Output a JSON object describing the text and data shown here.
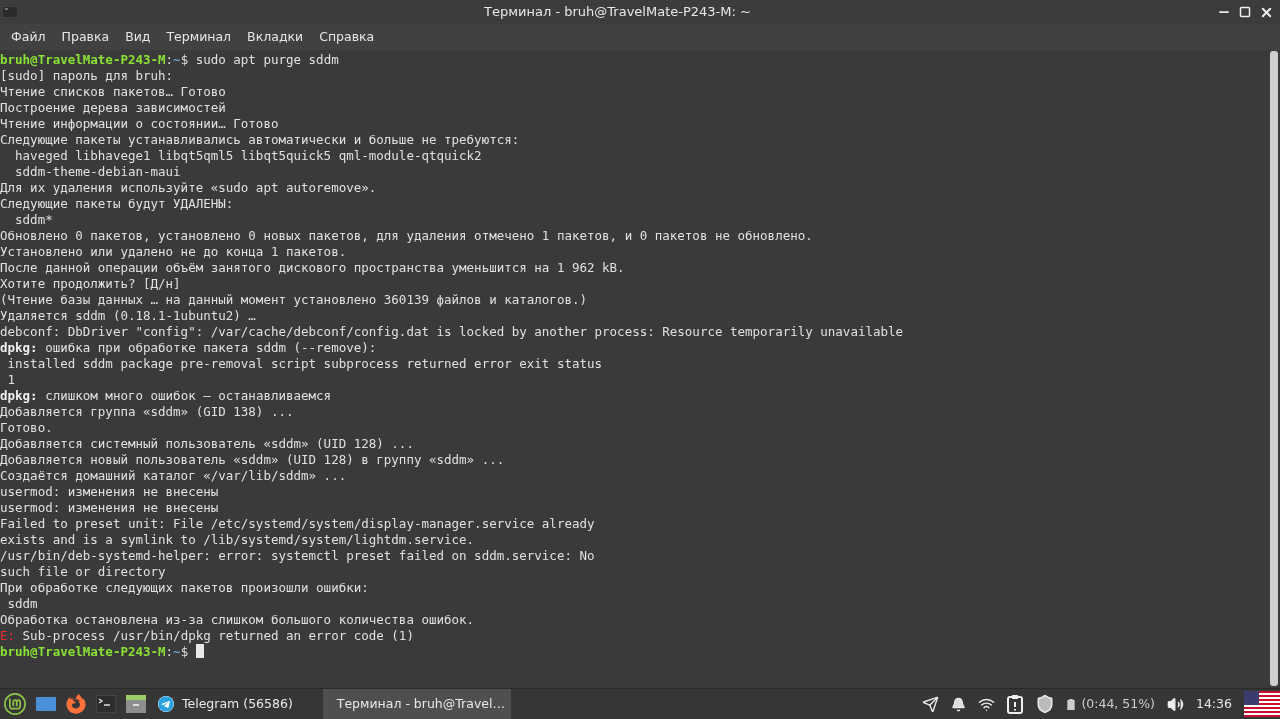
{
  "window": {
    "title": "Терминал - bruh@TravelMate-P243-M: ~"
  },
  "menu": [
    "Файл",
    "Правка",
    "Вид",
    "Терминал",
    "Вкладки",
    "Справка"
  ],
  "terminal": {
    "lines": [
      [
        {
          "kind": "user",
          "text": "bruh@TravelMate-P243-M"
        },
        {
          "kind": "plain",
          "text": ":"
        },
        {
          "kind": "path",
          "text": "~"
        },
        {
          "kind": "plain",
          "text": "$ sudo apt purge sddm"
        }
      ],
      [
        {
          "kind": "plain",
          "text": "[sudo] пароль для bruh:"
        }
      ],
      [
        {
          "kind": "plain",
          "text": "Чтение списков пакетов… Готово"
        }
      ],
      [
        {
          "kind": "plain",
          "text": "Построение дерева зависимостей"
        }
      ],
      [
        {
          "kind": "plain",
          "text": "Чтение информации о состоянии… Готово"
        }
      ],
      [
        {
          "kind": "plain",
          "text": "Следующие пакеты устанавливались автоматически и больше не требуются:"
        }
      ],
      [
        {
          "kind": "plain",
          "text": "  haveged libhavege1 libqt5qml5 libqt5quick5 qml-module-qtquick2"
        }
      ],
      [
        {
          "kind": "plain",
          "text": "  sddm-theme-debian-maui"
        }
      ],
      [
        {
          "kind": "plain",
          "text": "Для их удаления используйте «sudo apt autoremove»."
        }
      ],
      [
        {
          "kind": "plain",
          "text": "Следующие пакеты будут УДАЛЕНЫ:"
        }
      ],
      [
        {
          "kind": "plain",
          "text": "  sddm*"
        }
      ],
      [
        {
          "kind": "plain",
          "text": "Обновлено 0 пакетов, установлено 0 новых пакетов, для удаления отмечено 1 пакетов, и 0 пакетов не обновлено."
        }
      ],
      [
        {
          "kind": "plain",
          "text": "Установлено или удалено не до конца 1 пакетов."
        }
      ],
      [
        {
          "kind": "plain",
          "text": "После данной операции объём занятого дискового пространства уменьшится на 1 962 kB."
        }
      ],
      [
        {
          "kind": "plain",
          "text": "Хотите продолжить? [Д/н]"
        }
      ],
      [
        {
          "kind": "plain",
          "text": "(Чтение базы данных … на данный момент установлено 360139 файлов и каталогов.)"
        }
      ],
      [
        {
          "kind": "plain",
          "text": "Удаляется sddm (0.18.1-1ubuntu2) …"
        }
      ],
      [
        {
          "kind": "plain",
          "text": "debconf: DbDriver \"config\": /var/cache/debconf/config.dat is locked by another process: Resource temporarily unavailable"
        }
      ],
      [
        {
          "kind": "bold",
          "text": "dpkg:"
        },
        {
          "kind": "plain",
          "text": " ошибка при обработке пакета sddm (--remove):"
        }
      ],
      [
        {
          "kind": "plain",
          "text": " installed sddm package pre-removal script subprocess returned error exit status"
        }
      ],
      [
        {
          "kind": "plain",
          "text": " 1"
        }
      ],
      [
        {
          "kind": "bold",
          "text": "dpkg:"
        },
        {
          "kind": "plain",
          "text": " слишком много ошибок — останавливаемся"
        }
      ],
      [
        {
          "kind": "plain",
          "text": "Добавляется группа «sddm» (GID 138) ..."
        }
      ],
      [
        {
          "kind": "plain",
          "text": "Готово."
        }
      ],
      [
        {
          "kind": "plain",
          "text": "Добавляется системный пользователь «sddm» (UID 128) ..."
        }
      ],
      [
        {
          "kind": "plain",
          "text": "Добавляется новый пользователь «sddm» (UID 128) в группу «sddm» ..."
        }
      ],
      [
        {
          "kind": "plain",
          "text": "Создаётся домашний каталог «/var/lib/sddm» ..."
        }
      ],
      [
        {
          "kind": "plain",
          "text": "usermod: изменения не внесены"
        }
      ],
      [
        {
          "kind": "plain",
          "text": "usermod: изменения не внесены"
        }
      ],
      [
        {
          "kind": "plain",
          "text": "Failed to preset unit: File /etc/systemd/system/display-manager.service already"
        }
      ],
      [
        {
          "kind": "plain",
          "text": "exists and is a symlink to /lib/systemd/system/lightdm.service."
        }
      ],
      [
        {
          "kind": "plain",
          "text": "/usr/bin/deb-systemd-helper: error: systemctl preset failed on sddm.service: No"
        }
      ],
      [
        {
          "kind": "plain",
          "text": "such file or directory"
        }
      ],
      [
        {
          "kind": "plain",
          "text": "При обработке следующих пакетов произошли ошибки:"
        }
      ],
      [
        {
          "kind": "plain",
          "text": " sddm"
        }
      ],
      [
        {
          "kind": "plain",
          "text": "Обработка остановлена из-за слишком большого количества ошибок."
        }
      ],
      [
        {
          "kind": "error",
          "text": "E:"
        },
        {
          "kind": "plain",
          "text": " Sub-process /usr/bin/dpkg returned an error code (1)"
        }
      ],
      [
        {
          "kind": "user",
          "text": "bruh@TravelMate-P243-M"
        },
        {
          "kind": "plain",
          "text": ":"
        },
        {
          "kind": "path",
          "text": "~"
        },
        {
          "kind": "plain",
          "text": "$ "
        },
        {
          "kind": "cursor"
        }
      ]
    ]
  },
  "taskbar": {
    "windows": [
      {
        "kind": "telegram",
        "label": "Telegram (56586)",
        "selected": false
      },
      {
        "kind": "terminal",
        "label": "Терминал - bruh@Travel…",
        "selected": true
      }
    ],
    "battery": "(0:44, 51%)",
    "clock": "14:36"
  }
}
